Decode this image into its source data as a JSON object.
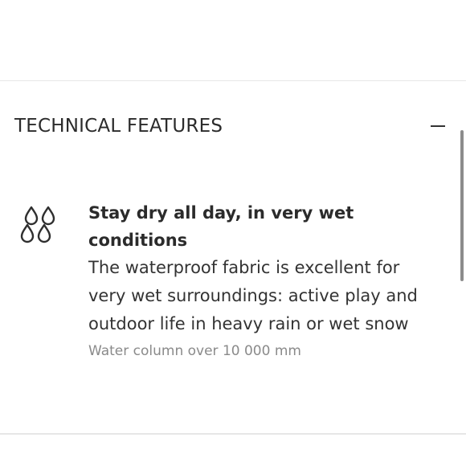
{
  "section": {
    "title": "TECHNICAL FEATURES",
    "toggle_icon": "minus-icon"
  },
  "feature": {
    "icon": "raindrops-icon",
    "title": "Stay dry all day, in very wet conditions",
    "description": "The waterproof fabric is excellent for very wet surroundings: active play and outdoor life in heavy rain or wet snow",
    "spec": "Water column over 10 000 mm"
  }
}
